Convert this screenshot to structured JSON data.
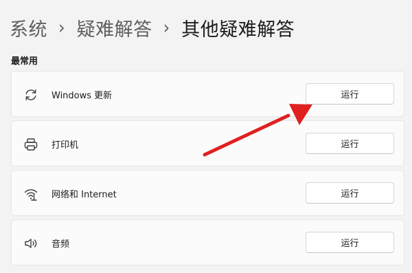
{
  "breadcrumb": {
    "items": [
      "系统",
      "疑难解答",
      "其他疑难解答"
    ],
    "separator": "›"
  },
  "section": {
    "title": "最常用"
  },
  "troubleshooters": [
    {
      "label": "Windows 更新",
      "icon": "sync-icon",
      "button": "运行"
    },
    {
      "label": "打印机",
      "icon": "printer-icon",
      "button": "运行"
    },
    {
      "label": "网络和 Internet",
      "icon": "wifi-icon",
      "button": "运行"
    },
    {
      "label": "音频",
      "icon": "speaker-icon",
      "button": "运行"
    }
  ],
  "colors": {
    "background": "#f3f3f3",
    "card": "#fbfbfb",
    "annotation_arrow": "#e02020"
  }
}
